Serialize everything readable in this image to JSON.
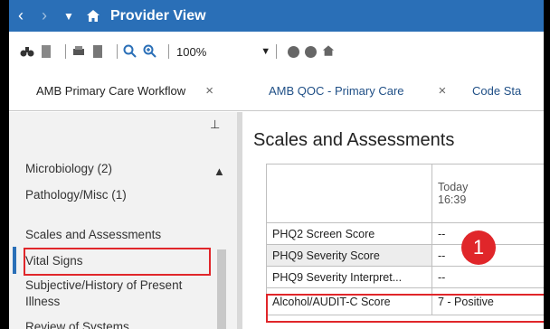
{
  "titlebar": {
    "back_icon": "chevron-left-icon",
    "forward_icon": "chevron-right-icon",
    "dropdown_icon": "caret-down-icon",
    "home_icon": "home-icon",
    "title": "Provider View",
    "color": "#2a6fb7"
  },
  "toolbar": {
    "zoom_label": "100%"
  },
  "tabs": [
    {
      "label": "AMB Primary Care Workflow",
      "close": "×"
    },
    {
      "label": "AMB QOC - Primary Care",
      "close": "×"
    },
    {
      "label": "Code Sta"
    }
  ],
  "sidebar": {
    "items": [
      {
        "label": "Microbiology (2)"
      },
      {
        "label": "Pathology/Misc (1)"
      },
      {
        "label": "Scales and Assessments"
      },
      {
        "label": "Vital Signs"
      },
      {
        "label": "Subjective/History of Present Illness"
      },
      {
        "label": "Review of Systems"
      }
    ]
  },
  "main": {
    "title": "Scales and Assessments",
    "column_header": {
      "day": "Today",
      "time": "16:39"
    },
    "rows": [
      {
        "label": "PHQ2 Screen Score",
        "value": "--"
      },
      {
        "label": "PHQ9 Severity Score",
        "value": "--"
      },
      {
        "label": "PHQ9 Severity Interpret...",
        "value": "--"
      },
      {
        "label": "Alcohol/AUDIT-C Score",
        "value": "7 - Positive"
      }
    ],
    "badge": "1"
  },
  "colors": {
    "accent": "#2a6fb7",
    "highlight": "#e0262a"
  }
}
